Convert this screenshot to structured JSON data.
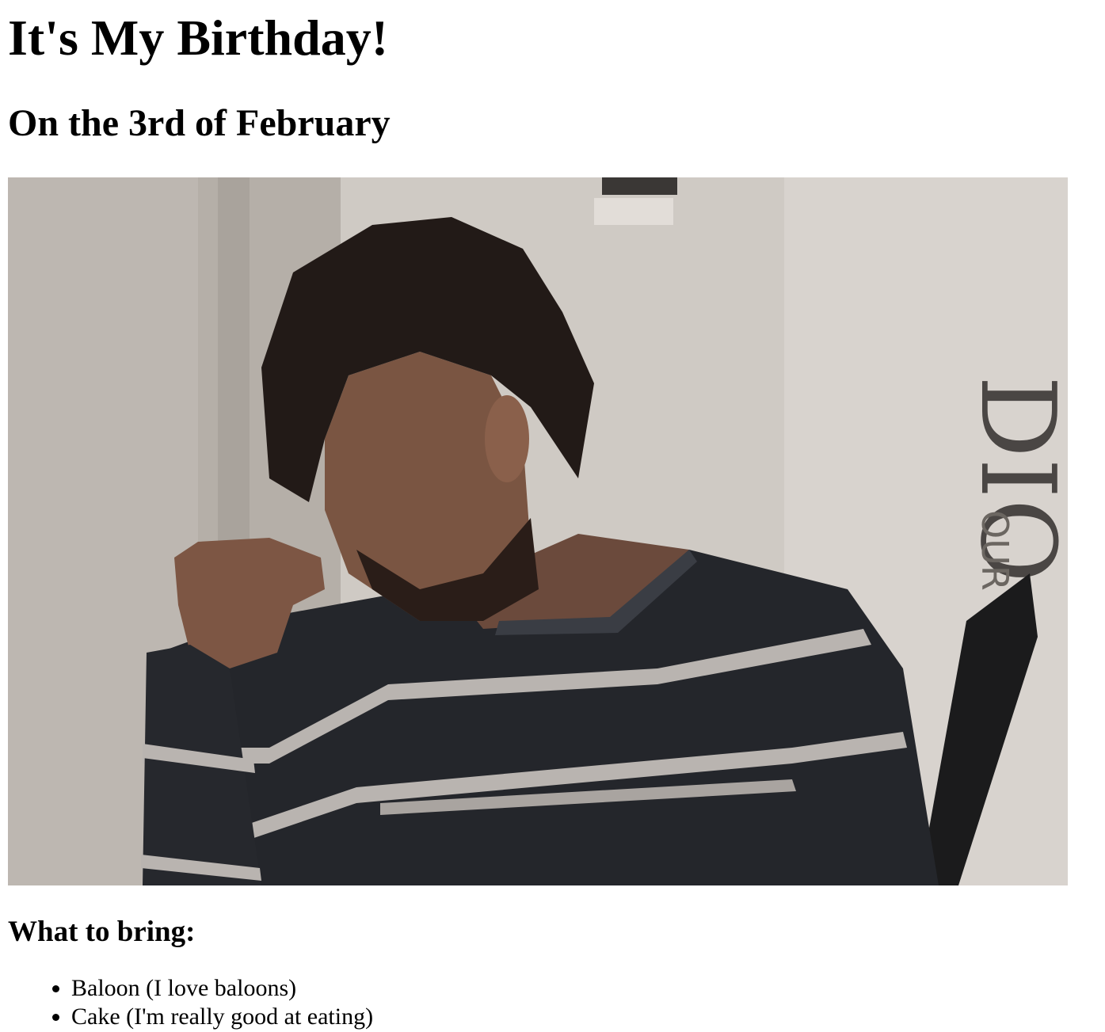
{
  "page": {
    "title": "It's My Birthday!",
    "subtitle": "On the 3rd of February",
    "photo": {
      "alt": ""
    },
    "bring_heading": "What to bring:",
    "bring_items": [
      "Baloon (I love baloons)",
      "Cake (I'm really good at eating)"
    ]
  }
}
